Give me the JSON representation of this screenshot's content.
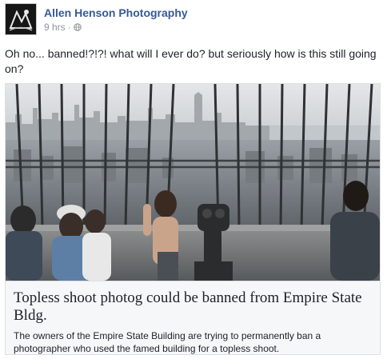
{
  "post": {
    "author": "Allen Henson Photography",
    "timestamp": "9 hrs",
    "separator": "·",
    "privacy_icon": "globe-icon",
    "text": "Oh no... banned!?!?! what will I ever do? but seriously how is this still going on?"
  },
  "link": {
    "title": "Topless shoot photog could be banned from Empire State Bldg.",
    "description": "The owners of the Empire State Building are trying to permanently ban a photographer who used the famed building for a topless shoot."
  },
  "colors": {
    "author_link": "#365899",
    "meta_gray": "#90949c",
    "card_background": "#f6f7f9",
    "card_border": "#dddfe2"
  }
}
